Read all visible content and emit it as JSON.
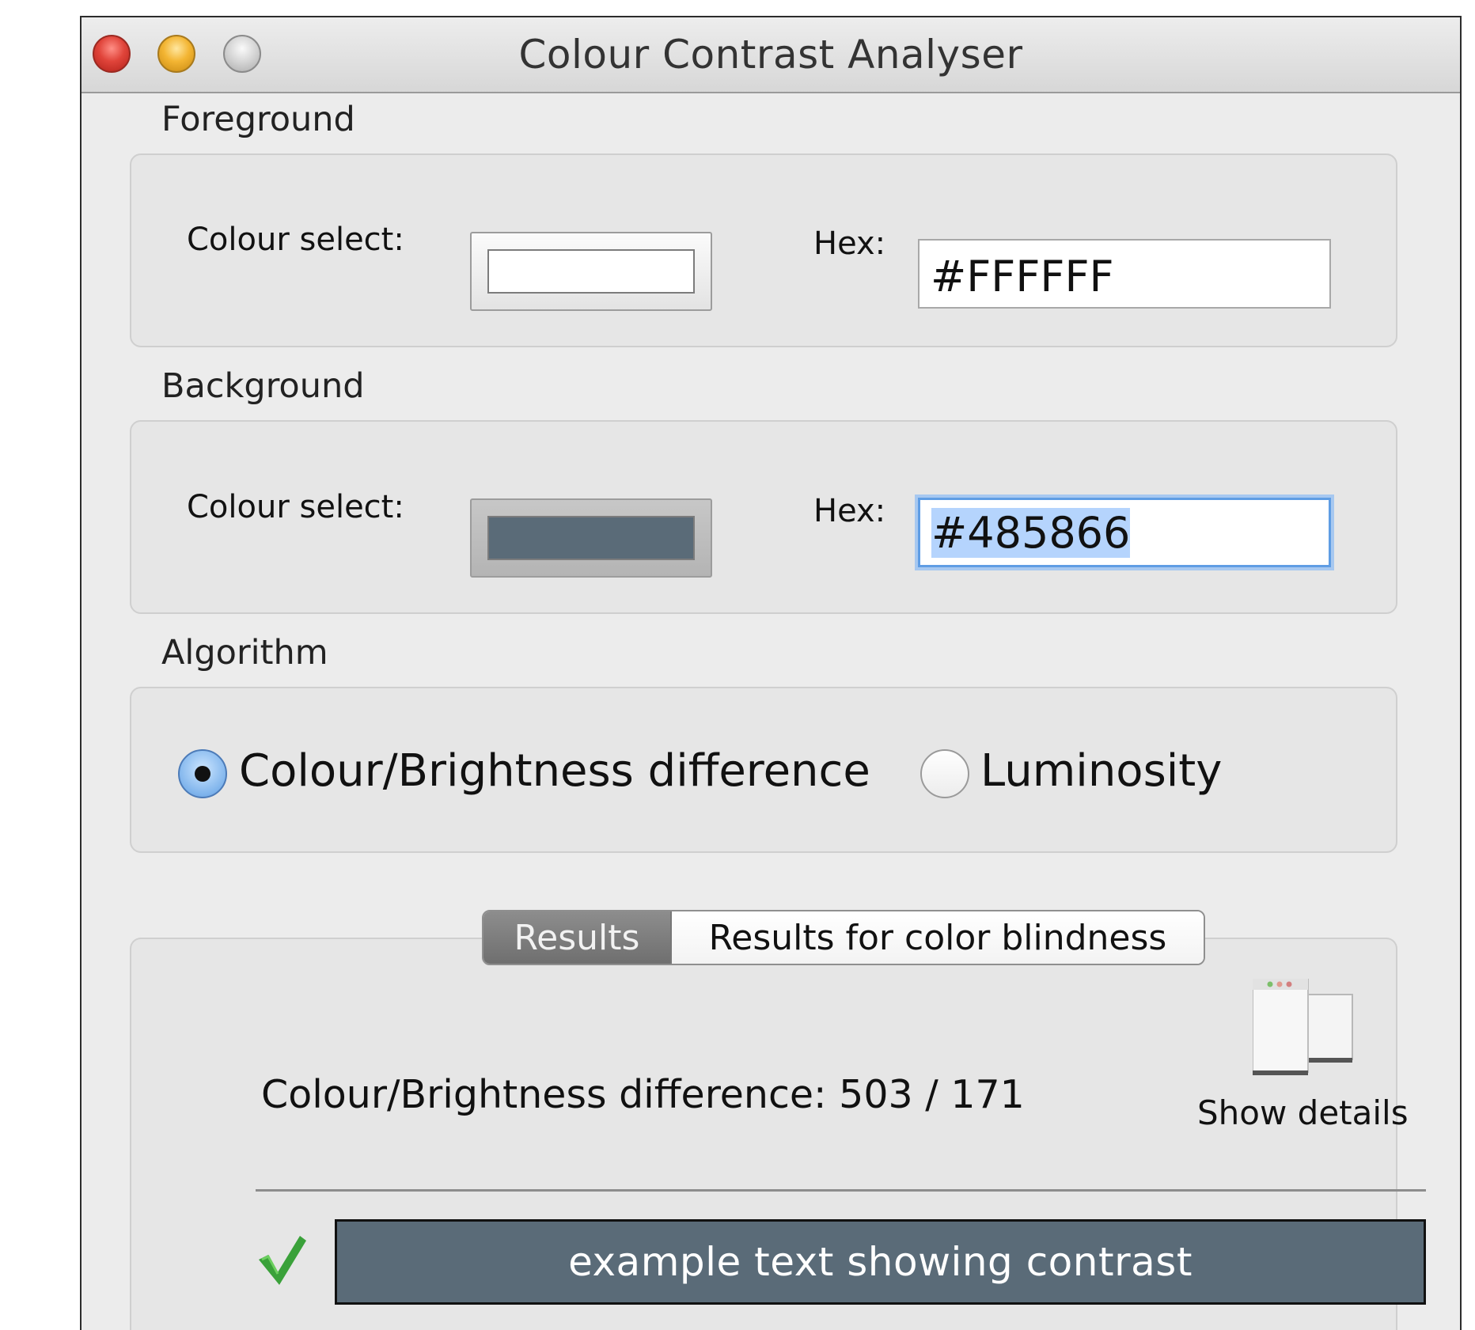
{
  "window": {
    "title": "Colour Contrast Analyser"
  },
  "foreground": {
    "section_label": "Foreground",
    "colour_select_label": "Colour select:",
    "hex_label": "Hex:",
    "hex_value": "#FFFFFF",
    "swatch_color": "#FFFFFF"
  },
  "background": {
    "section_label": "Background",
    "colour_select_label": "Colour select:",
    "hex_label": "Hex:",
    "hex_value": "#485866",
    "swatch_color": "#5A6B78"
  },
  "algorithm": {
    "section_label": "Algorithm",
    "options": [
      {
        "label": "Colour/Brightness difference",
        "selected": true
      },
      {
        "label": "Luminosity",
        "selected": false
      }
    ]
  },
  "results": {
    "tabs": [
      {
        "label": "Results",
        "active": true
      },
      {
        "label": "Results for color blindness",
        "active": false
      }
    ],
    "summary": "Colour/Brightness difference: 503 / 171",
    "show_details_label": "Show details",
    "status_icon": "check-icon",
    "status_color": "#3aa13a",
    "example_text": "example text showing contrast",
    "example_fg": "#FFFFFF",
    "example_bg": "#5A6B78"
  }
}
